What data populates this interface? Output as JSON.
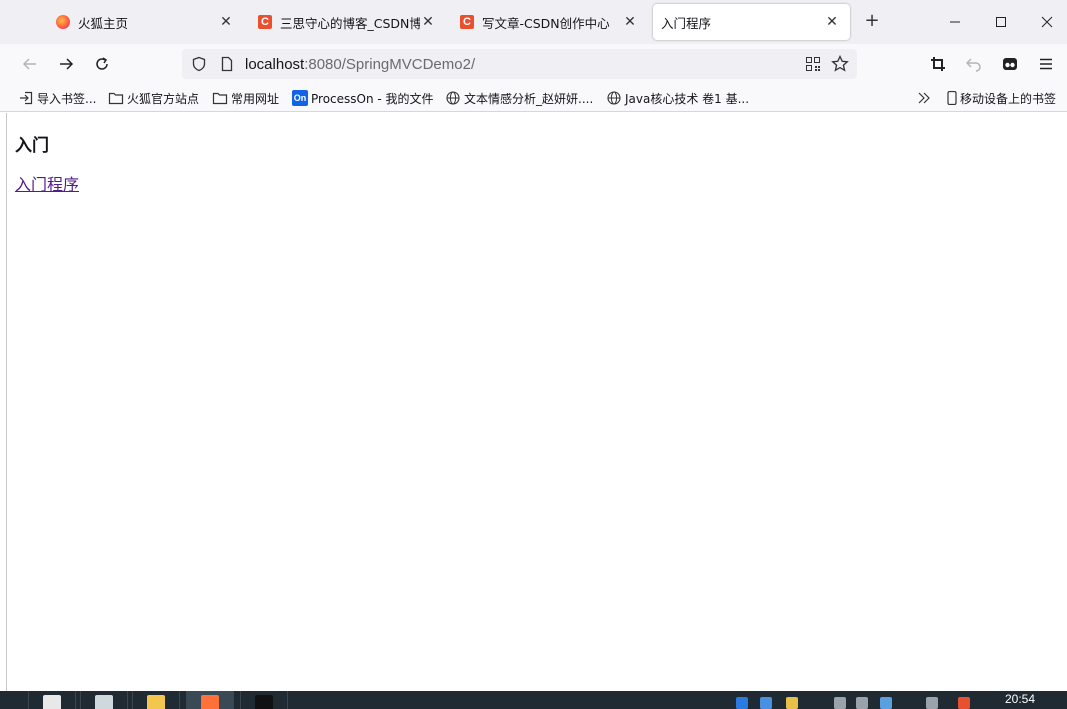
{
  "tabs": [
    {
      "title": "火狐主页",
      "favicon": "firefox-icon",
      "active": false
    },
    {
      "title": "三思守心的博客_CSDN博客",
      "favicon": "csdn-icon",
      "active": false
    },
    {
      "title": "写文章-CSDN创作中心",
      "favicon": "csdn-icon",
      "active": false
    },
    {
      "title": "入门程序",
      "favicon": "none",
      "active": true
    }
  ],
  "favicon_letter": "C",
  "urlbar": {
    "host": "localhost",
    "rest": ":8080/SpringMVCDemo2/"
  },
  "bookmarks": [
    {
      "label": "导入书签...",
      "icon": "import-icon"
    },
    {
      "label": "火狐官方站点",
      "icon": "folder-icon"
    },
    {
      "label": "常用网址",
      "icon": "folder-icon"
    },
    {
      "label": "ProcessOn - 我的文件",
      "icon": "processon-icon"
    },
    {
      "label": "文本情感分析_赵妍妍....",
      "icon": "globe-icon"
    },
    {
      "label": "Java核心技术 卷1 基...",
      "icon": "globe-icon"
    }
  ],
  "processon_badge": "On",
  "mobile_bookmarks": "移动设备上的书签",
  "page": {
    "heading": "入门",
    "link": "入门程序"
  },
  "taskbar": {
    "time": "20:54"
  },
  "colors": {
    "csdn": "#e9502f",
    "link_visited": "#551a8b",
    "tabstrip": "#f0f0f4"
  }
}
